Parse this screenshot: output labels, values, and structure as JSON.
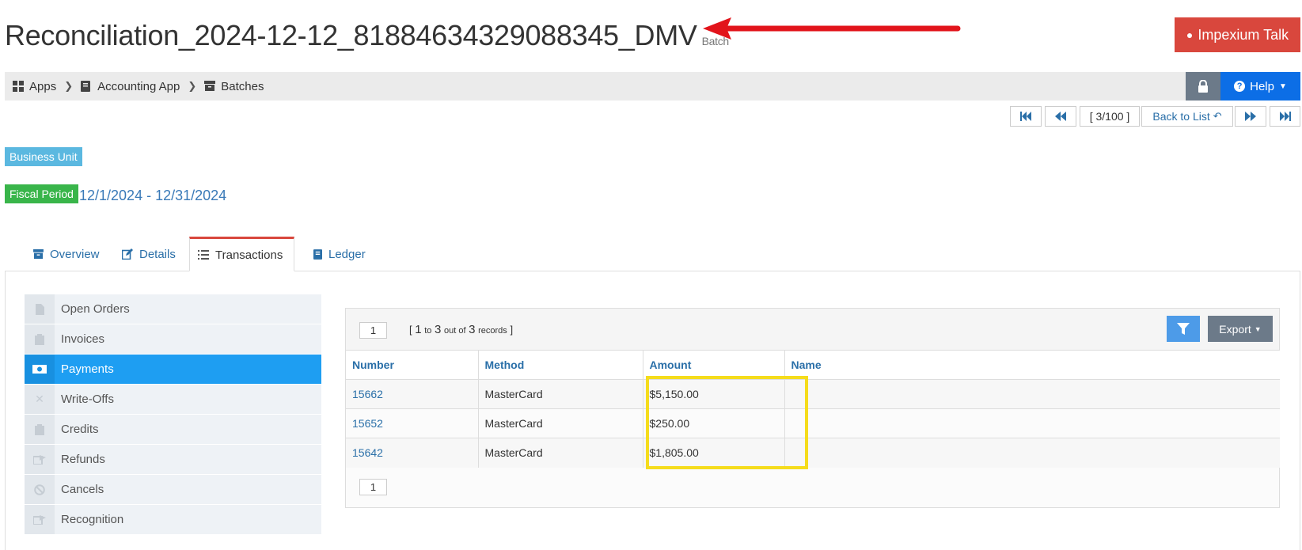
{
  "header": {
    "title": "Reconciliation_2024-12-12_81884634329088345_DMV",
    "subtitle": "Batch",
    "talk_button": "Impexium Talk"
  },
  "breadcrumb": {
    "items": [
      {
        "label": "Apps",
        "icon": "grid-icon"
      },
      {
        "label": "Accounting App",
        "icon": "book-icon"
      },
      {
        "label": "Batches",
        "icon": "archive-icon"
      }
    ],
    "help_label": "Help"
  },
  "pager": {
    "position": "[ 3/100 ]",
    "back_label": "Back to List"
  },
  "labels": {
    "business_unit": "Business Unit",
    "fiscal_period": "Fiscal Period",
    "period_value": "12/1/2024 - 12/31/2024"
  },
  "tabs": [
    {
      "label": "Overview",
      "icon": "archive-icon"
    },
    {
      "label": "Details",
      "icon": "edit-icon"
    },
    {
      "label": "Transactions",
      "icon": "list-icon",
      "active": true
    },
    {
      "label": "Ledger",
      "icon": "book-icon"
    }
  ],
  "sidenav": [
    {
      "label": "Open Orders",
      "icon": "file-icon"
    },
    {
      "label": "Invoices",
      "icon": "clipboard-icon"
    },
    {
      "label": "Payments",
      "icon": "money-icon",
      "active": true
    },
    {
      "label": "Write-Offs",
      "icon": "x-icon"
    },
    {
      "label": "Credits",
      "icon": "clipboard-icon"
    },
    {
      "label": "Refunds",
      "icon": "share-icon"
    },
    {
      "label": "Cancels",
      "icon": "ban-icon"
    },
    {
      "label": "Recognition",
      "icon": "share-icon"
    }
  ],
  "grid": {
    "page": "1",
    "records": {
      "open": "[",
      "from": "1",
      "to_word": "to",
      "to": "3",
      "outof_word": "out of",
      "total": "3",
      "records_word": "records",
      "close": "]"
    },
    "export_label": "Export",
    "columns": [
      "Number",
      "Method",
      "Amount",
      "Name"
    ],
    "rows": [
      {
        "number": "15662",
        "method": "MasterCard",
        "amount": "$5,150.00",
        "name": ""
      },
      {
        "number": "15652",
        "method": "MasterCard",
        "amount": "$250.00",
        "name": ""
      },
      {
        "number": "15642",
        "method": "MasterCard",
        "amount": "$1,805.00",
        "name": ""
      }
    ],
    "bottom_page": "1"
  },
  "colors": {
    "accent_red": "#d9473d",
    "link_blue": "#2a6fa8",
    "active_blue": "#1e9ef2",
    "highlight_yellow": "#f5dc1c"
  }
}
